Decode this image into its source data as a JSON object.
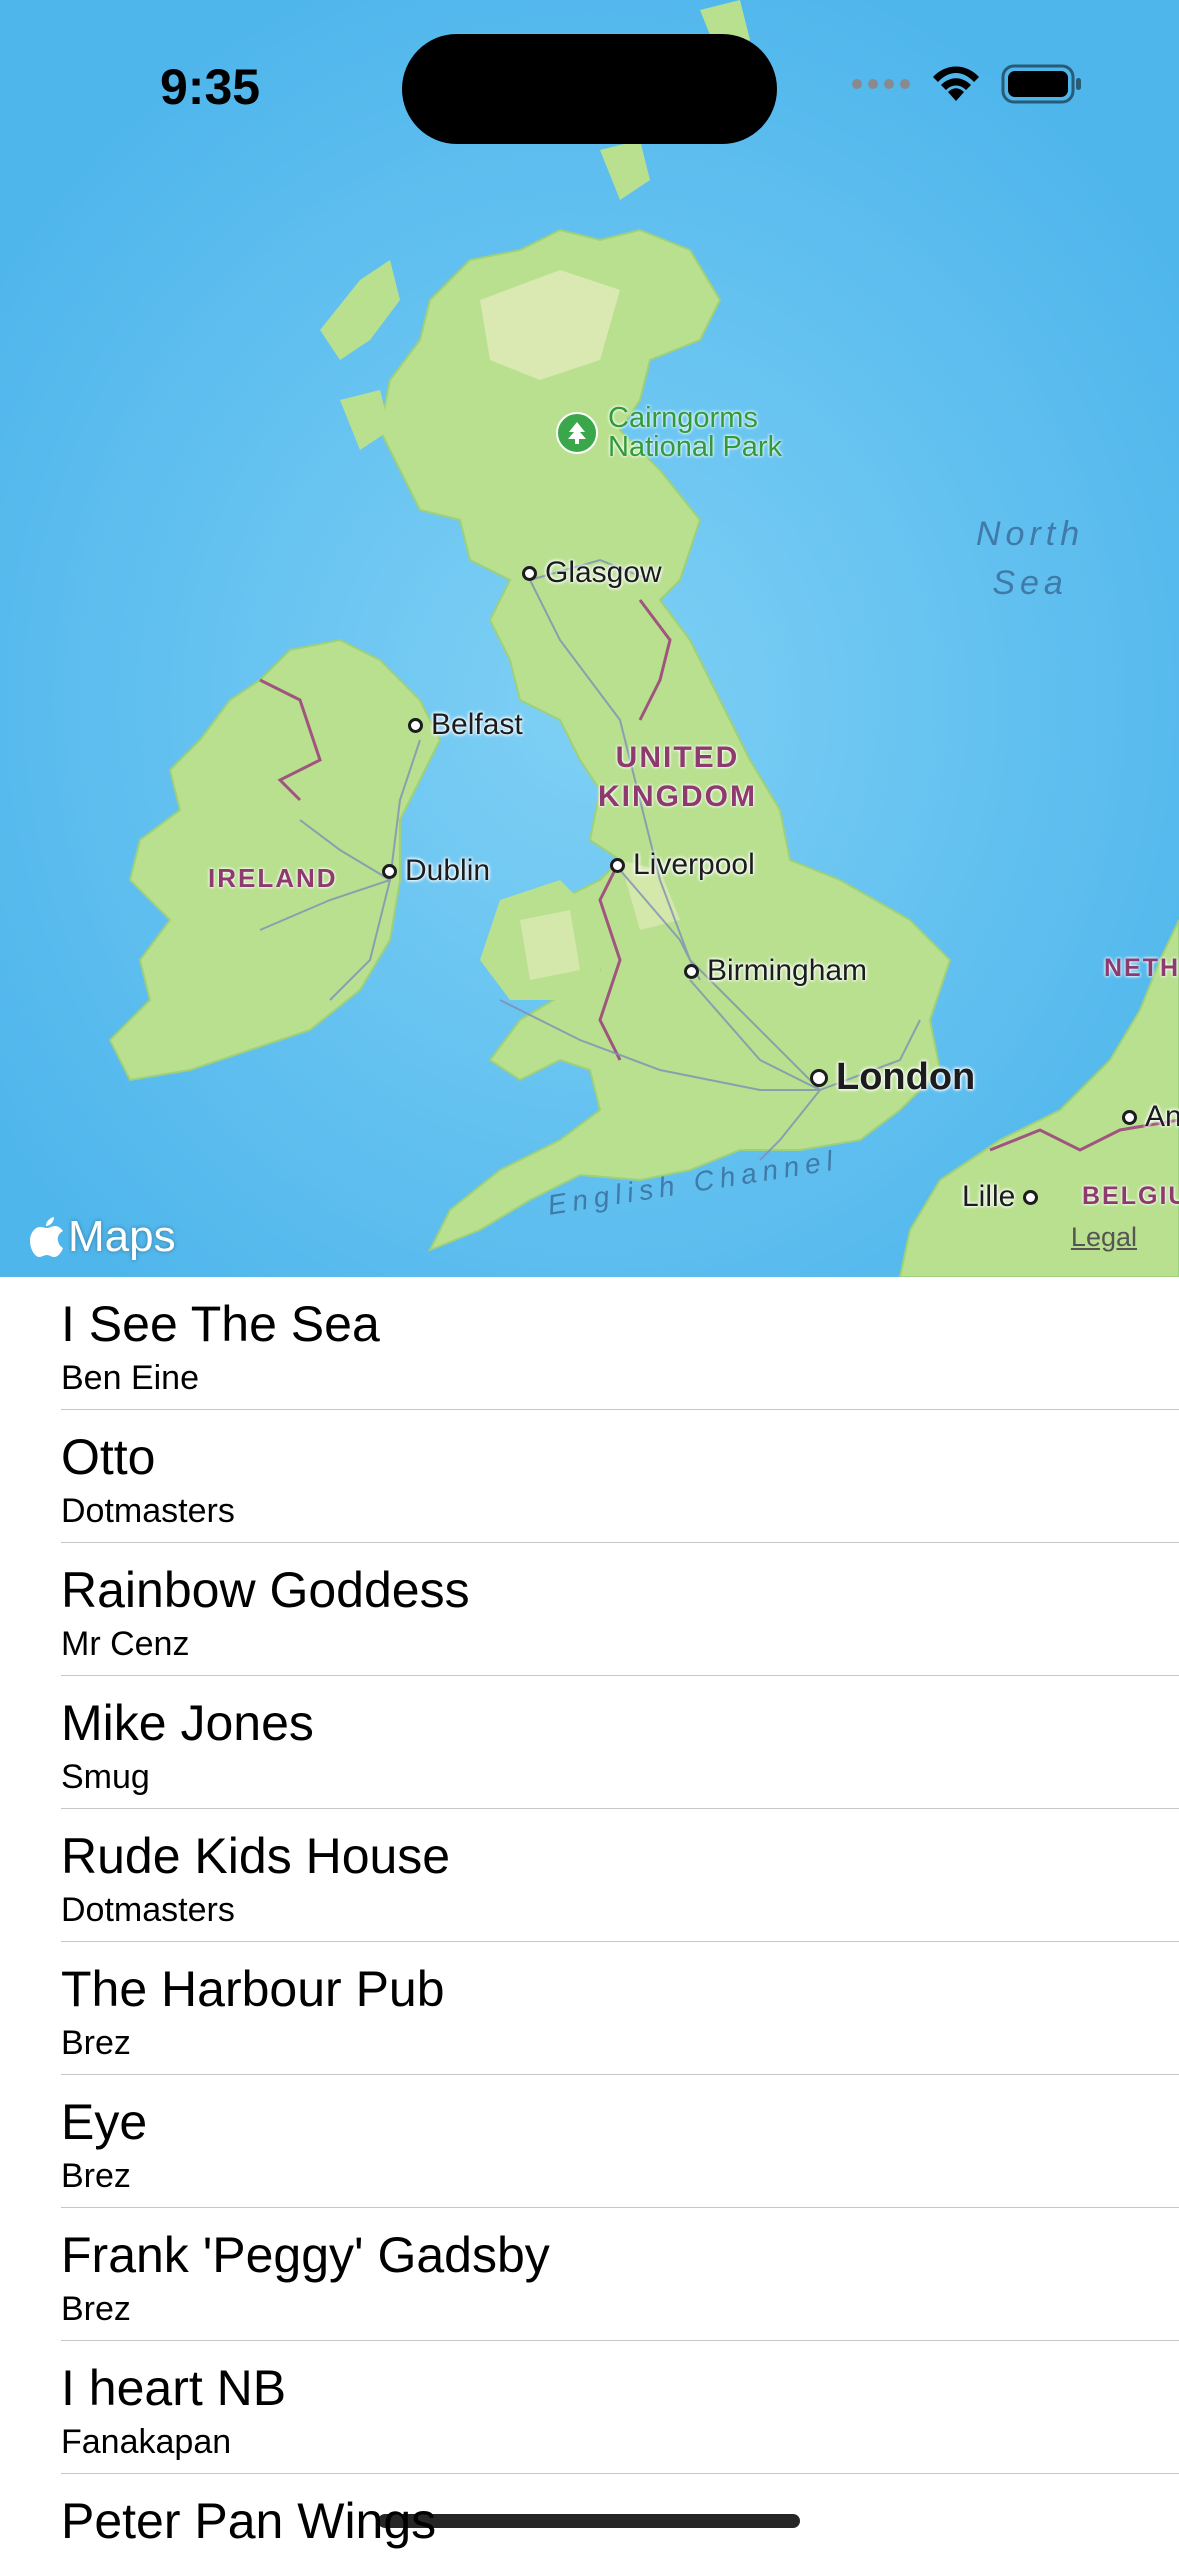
{
  "status_bar": {
    "time": "9:35",
    "signal_icon": "signal-dots-icon",
    "wifi_icon": "wifi-icon",
    "battery_icon": "battery-icon"
  },
  "map": {
    "attribution": "Maps",
    "legal": "Legal",
    "park": "Cairngorms\nNational Park",
    "sea_north": "North\nSea",
    "channel": "English Channel",
    "countries": {
      "uk": "UNITED\nKINGDOM",
      "ireland": "IRELAND",
      "netherlands": "NETH",
      "belgium": "BELGIU"
    },
    "cities": {
      "glasgow": "Glasgow",
      "belfast": "Belfast",
      "dublin": "Dublin",
      "liverpool": "Liverpool",
      "birmingham": "Birmingham",
      "london": "London",
      "lille": "Lille",
      "antwerp": "An"
    },
    "colors": {
      "water": "#5ec1f2",
      "land": "#b8e08f",
      "border": "#a0557e",
      "road": "#7f8fb5"
    }
  },
  "list": {
    "items": [
      {
        "title": "I See The Sea",
        "subtitle": "Ben Eine"
      },
      {
        "title": "Otto",
        "subtitle": "Dotmasters"
      },
      {
        "title": "Rainbow Goddess",
        "subtitle": "Mr Cenz"
      },
      {
        "title": "Mike Jones",
        "subtitle": "Smug"
      },
      {
        "title": "Rude Kids House",
        "subtitle": "Dotmasters"
      },
      {
        "title": "The Harbour Pub",
        "subtitle": "Brez"
      },
      {
        "title": "Eye",
        "subtitle": "Brez"
      },
      {
        "title": "Frank 'Peggy' Gadsby",
        "subtitle": "Brez"
      },
      {
        "title": "I heart NB",
        "subtitle": "Fanakapan"
      },
      {
        "title": "Peter Pan Wings",
        "subtitle": ""
      }
    ]
  }
}
